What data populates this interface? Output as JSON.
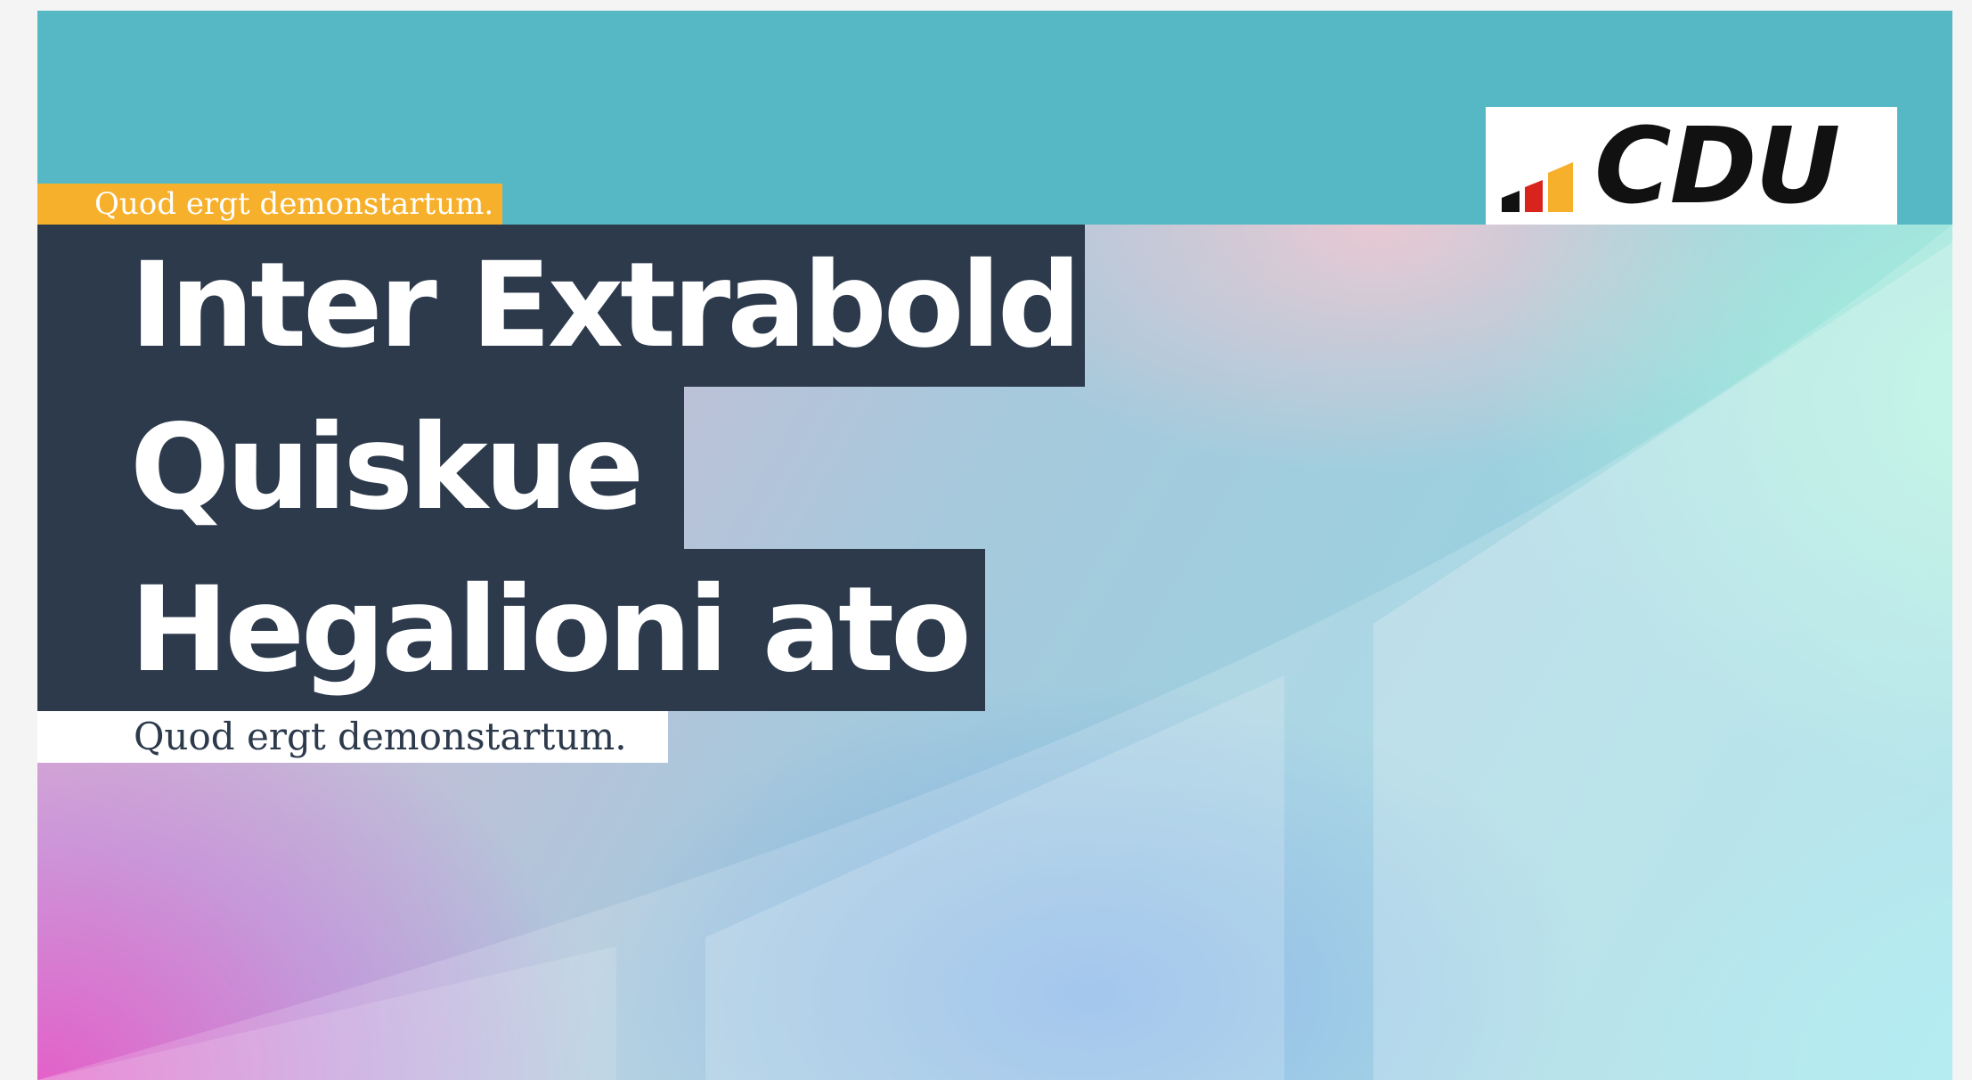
{
  "colors": {
    "sky": "#56b8c4",
    "navy": "#2c3a4c",
    "gold": "#f7b02b",
    "white": "#ffffff",
    "logo_black": "#111111",
    "logo_red": "#d9231d"
  },
  "subline_top": "Quod ergt demonstartum.",
  "headline": {
    "line1": "Inter Extrabold",
    "line2": "Quiskue",
    "line3": "Hegalioni ato"
  },
  "subline_bottom": "Quod ergt demonstartum.",
  "logo": {
    "text": "CDU",
    "icon": "cdu-bars-icon"
  }
}
